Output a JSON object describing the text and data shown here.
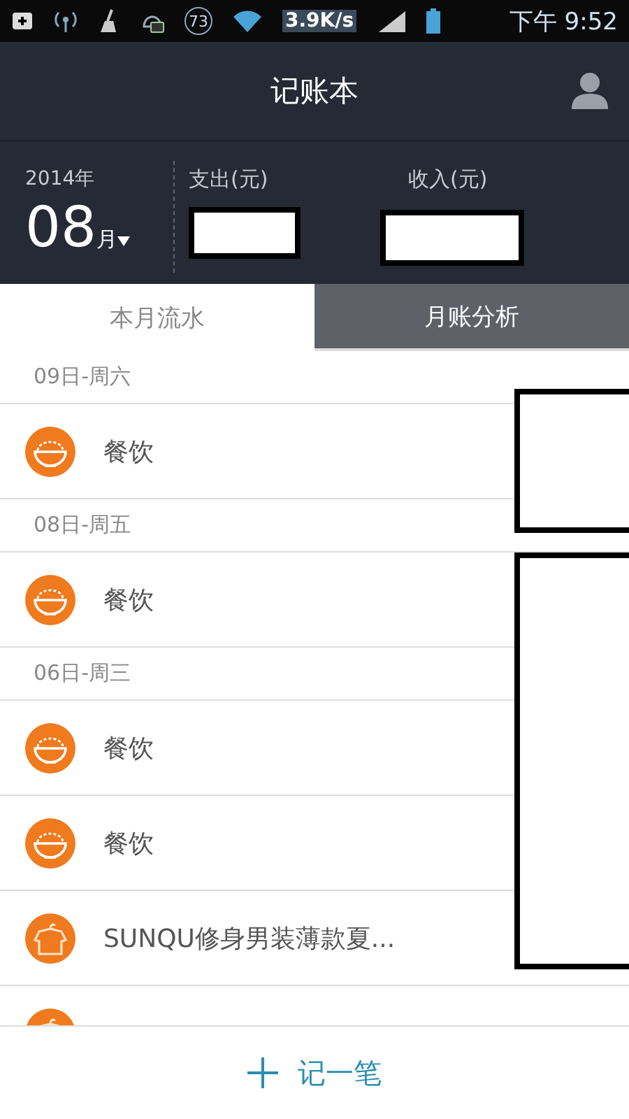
{
  "status_bar": {
    "notification_count": "73",
    "speed": "3.9K/s",
    "time": "下午 9:52"
  },
  "header": {
    "title": "记账本"
  },
  "summary": {
    "year": "2014年",
    "month": "08",
    "month_unit": "月",
    "expense_label": "支出(元)",
    "income_label": "收入(元)"
  },
  "tabs": [
    {
      "label": "本月流水",
      "selected": true
    },
    {
      "label": "月账分析",
      "selected": false
    }
  ],
  "days": [
    {
      "date": "09日-周六",
      "entries": [
        {
          "kind": "food",
          "name": "餐饮"
        }
      ]
    },
    {
      "date": "08日-周五",
      "entries": [
        {
          "kind": "food",
          "name": "餐饮"
        }
      ]
    },
    {
      "date": "06日-周三",
      "entries": [
        {
          "kind": "food",
          "name": "餐饮"
        },
        {
          "kind": "food",
          "name": "餐饮"
        },
        {
          "kind": "clothing",
          "name": "SUNQU修身男装薄款夏..."
        },
        {
          "kind": "clothing"
        }
      ]
    }
  ],
  "footer": {
    "label": "记一笔"
  }
}
